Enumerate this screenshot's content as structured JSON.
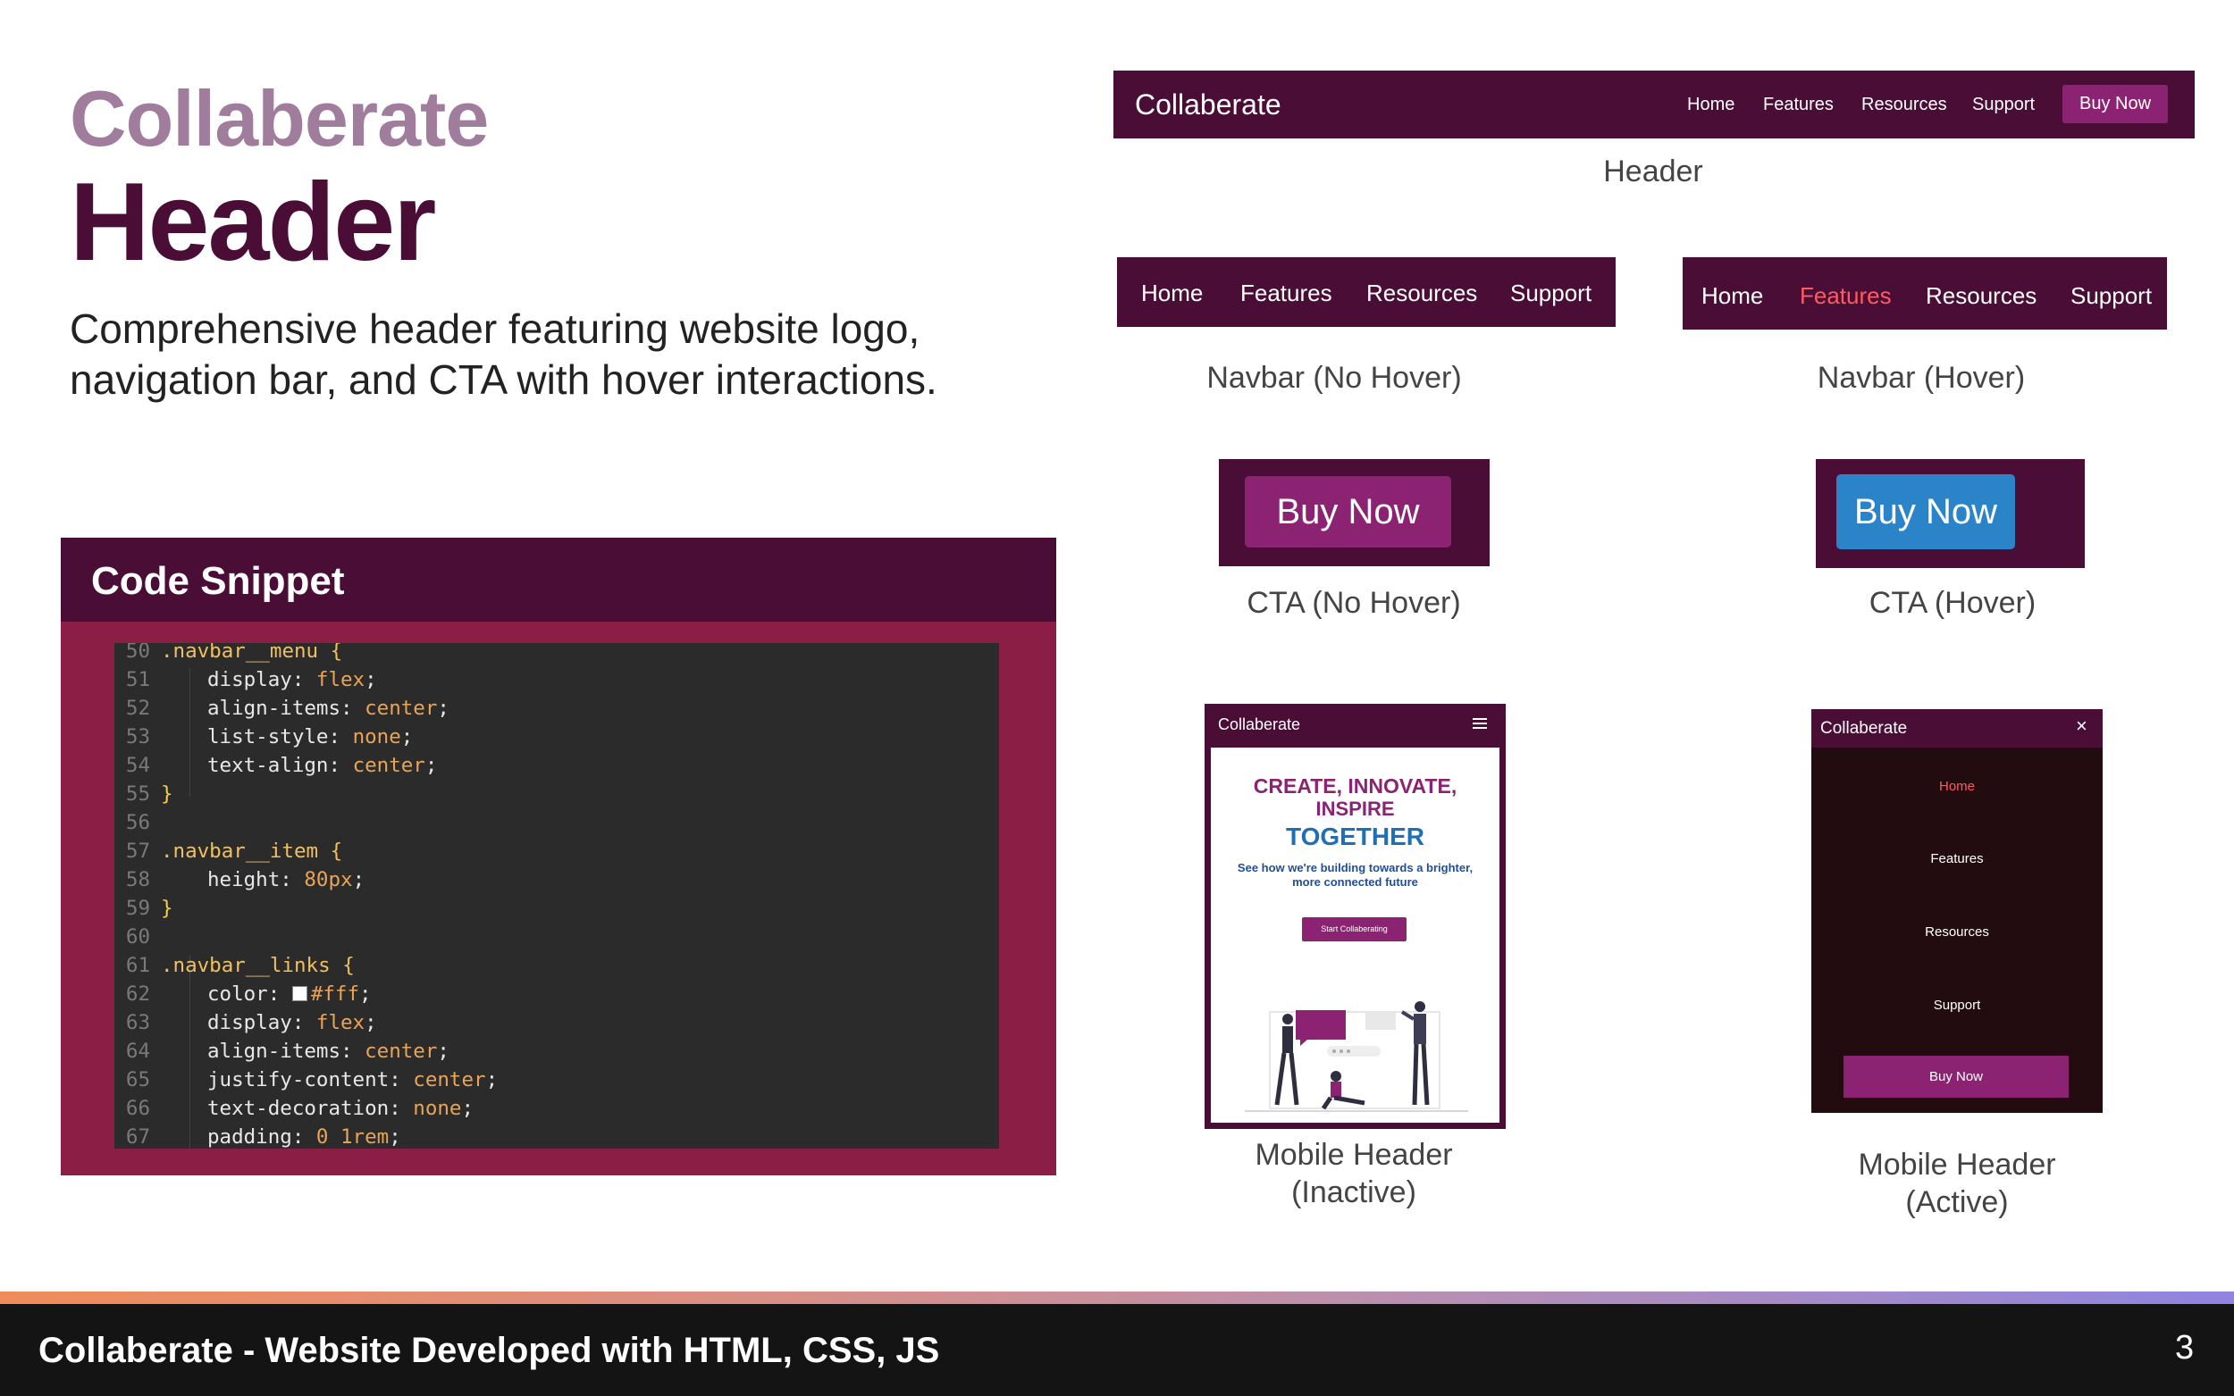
{
  "slide": {
    "brand": "Collaberate",
    "title": "Header",
    "description": "Comprehensive header featuring website logo, navigation bar, and CTA with hover interactions."
  },
  "code_snippet": {
    "title": "Code Snippet",
    "lines": [
      {
        "n": "50",
        "text": ".navbar__menu {"
      },
      {
        "n": "51",
        "text": "display: flex;"
      },
      {
        "n": "52",
        "text": "align-items: center;"
      },
      {
        "n": "53",
        "text": "list-style: none;"
      },
      {
        "n": "54",
        "text": "text-align: center;"
      },
      {
        "n": "55",
        "text": "}"
      },
      {
        "n": "56",
        "text": ""
      },
      {
        "n": "57",
        "text": ".navbar__item {"
      },
      {
        "n": "58",
        "text": "height: 80px;"
      },
      {
        "n": "59",
        "text": "}"
      },
      {
        "n": "60",
        "text": ""
      },
      {
        "n": "61",
        "text": ".navbar__links {"
      },
      {
        "n": "62",
        "text": "color: #fff;"
      },
      {
        "n": "63",
        "text": "display: flex;"
      },
      {
        "n": "64",
        "text": "align-items: center;"
      },
      {
        "n": "65",
        "text": "justify-content: center;"
      },
      {
        "n": "66",
        "text": "text-decoration: none;"
      },
      {
        "n": "67",
        "text": "padding: 0 1rem;"
      }
    ]
  },
  "header_demo": {
    "logo": "Collaberate",
    "nav": [
      "Home",
      "Features",
      "Resources",
      "Support"
    ],
    "cta": "Buy Now",
    "caption": "Header"
  },
  "navbar_no_hover": {
    "items": [
      "Home",
      "Features",
      "Resources",
      "Support"
    ],
    "caption": "Navbar (No Hover)"
  },
  "navbar_hover": {
    "items": [
      "Home",
      "Features",
      "Resources",
      "Support"
    ],
    "hovered": "Features",
    "caption": "Navbar (Hover)"
  },
  "cta_no_hover": {
    "label": "Buy Now",
    "caption": "CTA (No Hover)"
  },
  "cta_hover": {
    "label": "Buy Now",
    "caption": "CTA (Hover)"
  },
  "mobile_inactive": {
    "logo": "Collaberate",
    "hero_line1": "CREATE, INNOVATE,",
    "hero_line2": "INSPIRE",
    "hero_line3": "TOGETHER",
    "subtitle": "See how we're building towards a brighter, more connected future",
    "button": "Start Collaberating",
    "caption_line1": "Mobile Header",
    "caption_line2": "(Inactive)"
  },
  "mobile_active": {
    "logo": "Collaberate",
    "close_icon": "×",
    "links": [
      "Home",
      "Features",
      "Resources",
      "Support"
    ],
    "cta": "Buy Now",
    "caption_line1": "Mobile Header",
    "caption_line2": "(Active)"
  },
  "footer": {
    "text": "Collaberate - Website Developed with  HTML, CSS, JS",
    "page_number": "3"
  },
  "colors": {
    "brand_dark": "#4a0e36",
    "brand_muted": "#a07c9d",
    "cta": "#8b2372",
    "cta_hover": "#2b84c8",
    "nav_hover": "#ff5a5f",
    "code_frame": "#8b1e44"
  }
}
